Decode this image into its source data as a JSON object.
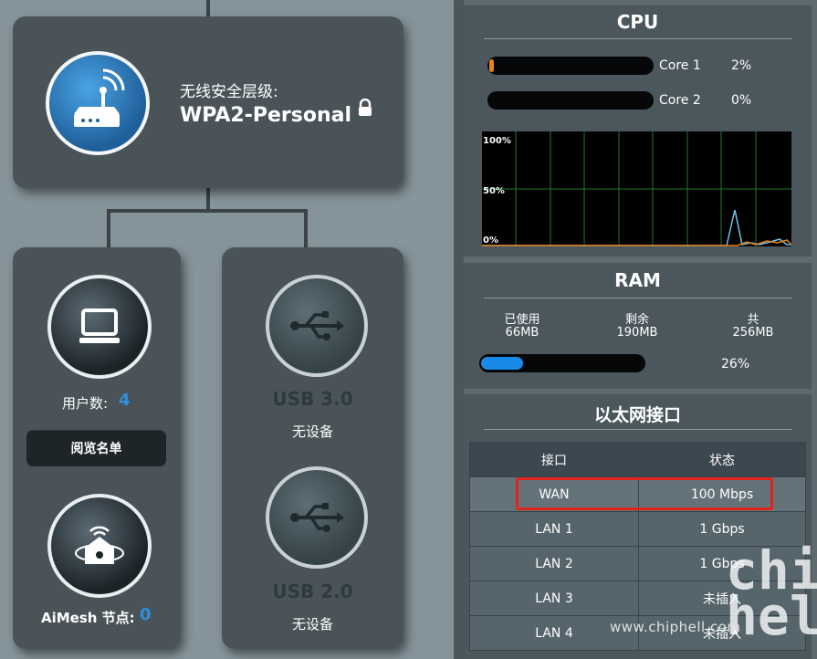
{
  "security": {
    "label": "无线安全层级:",
    "value": "WPA2-Personal",
    "lock_icon": "lock-icon",
    "router_icon": "router-wifi-icon"
  },
  "clients": {
    "label": "用户数:",
    "count": "4",
    "button": "阅览名单",
    "icon": "monitor-icon"
  },
  "aimesh": {
    "label": "AiMesh 节点:",
    "count": "0",
    "icon": "mesh-home-icon"
  },
  "usb": [
    {
      "name": "USB 3.0",
      "status": "无设备",
      "icon": "usb-icon"
    },
    {
      "name": "USB 2.0",
      "status": "无设备",
      "icon": "usb-icon"
    }
  ],
  "cpu": {
    "title": "CPU",
    "cores": [
      {
        "name": "Core 1",
        "percent": "2%",
        "usage": 2
      },
      {
        "name": "Core 2",
        "percent": "0%",
        "usage": 0
      }
    ],
    "chart_labels": {
      "top": "100%",
      "mid": "50%",
      "bottom": "0%"
    }
  },
  "ram": {
    "title": "RAM",
    "used_label": "已使用",
    "used_value": "66MB",
    "free_label": "剩余",
    "free_value": "190MB",
    "total_label": "共",
    "total_value": "256MB",
    "percent": "26%",
    "usage": 26
  },
  "ethernet": {
    "title": "以太网接口",
    "headers": [
      "接口",
      "状态"
    ],
    "rows": [
      {
        "port": "WAN",
        "status": "100 Mbps"
      },
      {
        "port": "LAN 1",
        "status": "1 Gbps"
      },
      {
        "port": "LAN 2",
        "status": "1 Gbps"
      },
      {
        "port": "LAN 3",
        "status": "未插入"
      },
      {
        "port": "LAN 4",
        "status": "未插入"
      }
    ]
  },
  "watermark": {
    "site": "www.chiphell.com",
    "logo": "chip hell"
  },
  "colors": {
    "accent_blue": "#2e8fe0",
    "core_orange": "#e8821e",
    "ram_blue": "#1a8ae8",
    "highlight_red": "#e2231a"
  }
}
